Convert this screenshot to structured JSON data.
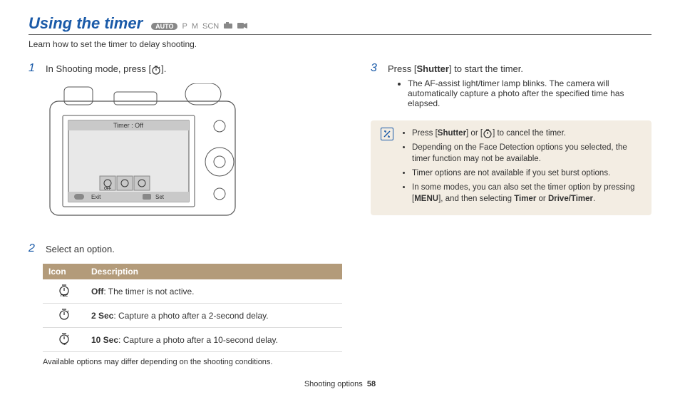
{
  "title": "Using the timer",
  "modes": {
    "auto": "AUTO",
    "p": "P",
    "m": "M",
    "scn": "SCN"
  },
  "intro": "Learn how to set the timer to delay shooting.",
  "step1": {
    "num": "1",
    "text_a": "In Shooting mode, press [",
    "text_b": "]."
  },
  "step2": {
    "num": "2",
    "text": "Select an option."
  },
  "step3": {
    "num": "3",
    "text_a": "Press [",
    "text_bold": "Shutter",
    "text_b": "] to start the timer.",
    "bullet1": "The AF-assist light/timer lamp blinks. The camera will automatically capture a photo after the specified time has elapsed."
  },
  "camera_screen": {
    "title": "Timer : Off",
    "exit": "Exit",
    "set": "Set"
  },
  "table": {
    "head_icon": "Icon",
    "head_desc": "Description",
    "rows": [
      {
        "bold": "Off",
        "rest": ": The timer is not active."
      },
      {
        "bold": "2 Sec",
        "rest": ": Capture a photo after a 2-second delay."
      },
      {
        "bold": "10 Sec",
        "rest": ": Capture a photo after a 10-second delay."
      }
    ]
  },
  "table_note": "Available options may differ depending on the shooting conditions.",
  "infobox": {
    "b1_a": "Press [",
    "b1_bold1": "Shutter",
    "b1_mid": "] or [",
    "b1_b": "] to cancel the timer.",
    "b2": "Depending on the Face Detection options you selected, the timer function may not be available.",
    "b3": "Timer options are not available if you set burst options.",
    "b4_a": "In some modes, you can also set the timer option by pressing [",
    "b4_menu": "MENU",
    "b4_b": "], and then selecting ",
    "b4_bold1": "Timer",
    "b4_or": " or ",
    "b4_bold2": "Drive/Timer",
    "b4_end": "."
  },
  "footer": {
    "section": "Shooting options",
    "page": "58"
  }
}
